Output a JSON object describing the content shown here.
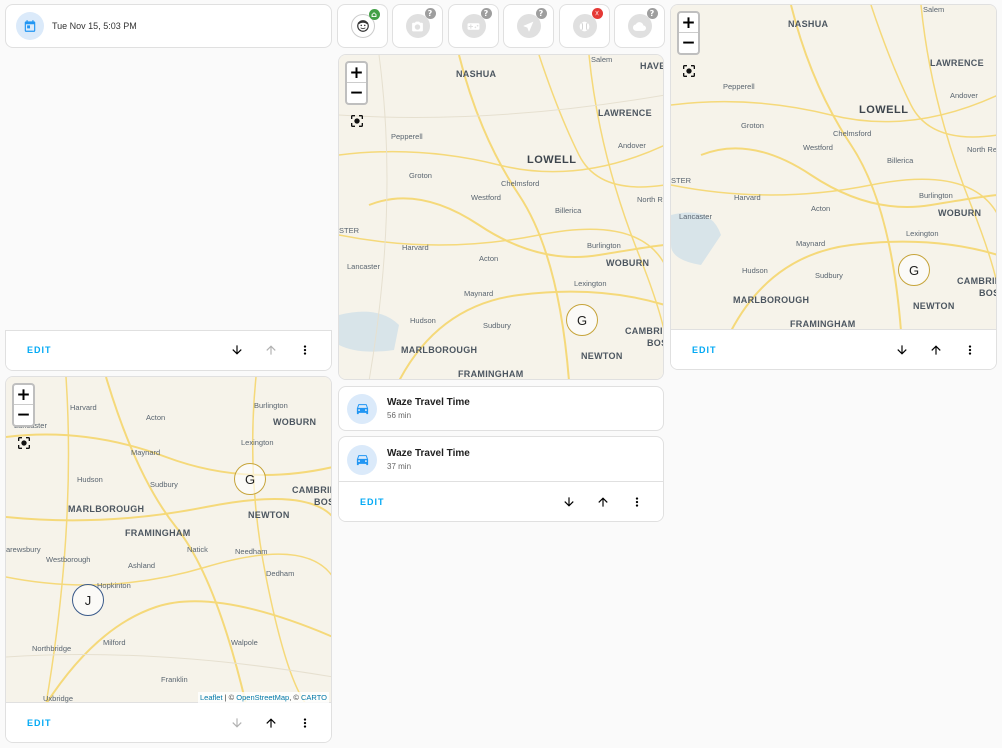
{
  "date_card": {
    "datetime": "Tue Nov 15, 5:03 PM",
    "icon": "calendar-icon"
  },
  "card_actions": {
    "edit_label": "EDIT"
  },
  "badges": [
    {
      "name": "person-badge",
      "icon": "face-icon",
      "state_badge": "home",
      "badge_color": "#43a047"
    },
    {
      "name": "camera-badge",
      "icon": "camera-icon",
      "state_badge": "?"
    },
    {
      "name": "gamepad-badge",
      "icon": "gamepad-icon",
      "state_badge": "?"
    },
    {
      "name": "navigation-badge",
      "icon": "navigation-icon",
      "state_badge": "?"
    },
    {
      "name": "baseball-badge",
      "icon": "baseball-icon",
      "state_badge": "away",
      "badge_color": "#e53935"
    },
    {
      "name": "weather-badge",
      "icon": "weather-icon",
      "state_badge": "?"
    }
  ],
  "travel": [
    {
      "name": "Waze Travel Time",
      "state": "56 min",
      "icon": "car-icon"
    },
    {
      "name": "Waze Travel Time",
      "state": "37 min",
      "icon": "car-icon"
    }
  ],
  "map_labels": {
    "bigcity": [
      "LOWELL"
    ],
    "cities": [
      "NASHUA",
      "LAWRENCE",
      "WOBURN",
      "MARLBOROUGH",
      "NEWTON",
      "FRAMINGHAM",
      "CAMBRIDGE",
      "BOS",
      "HAVER",
      "North Re"
    ],
    "towns": [
      "Salem",
      "Andover",
      "Pepperell",
      "Groton",
      "Chelmsford",
      "Westford",
      "Billerica",
      "North Re",
      "Harvard",
      "Acton",
      "Burlington",
      "Lancaster",
      "Maynard",
      "Lexington",
      "Hudson",
      "Sudbury",
      "STER"
    ],
    "sw_cities": [
      "WOBURN",
      "MARLBOROUGH",
      "NEWTON",
      "FRAMINGHAM",
      "CAMBRIDGE",
      "BOS"
    ],
    "sw_towns": [
      "Harvard",
      "Acton",
      "Burlington",
      "Lancaster",
      "Lexington",
      "Maynard",
      "Hudson",
      "Sudbury",
      "Natick",
      "Needham",
      "Westborough",
      "Ashland",
      "Hopkinton",
      "Dedham",
      "Northbridge",
      "Milford",
      "Walpole",
      "Franklin",
      "Uxbridge",
      "arewsbury"
    ]
  },
  "markers": {
    "g": "G",
    "j": "J"
  },
  "attribution": {
    "leaflet": "Leaflet",
    "sep1": " | © ",
    "osm": "OpenStreetMap",
    "sep2": ", © ",
    "carto": "CARTO"
  },
  "zoom": {
    "in": "+",
    "out": "−"
  },
  "colors": {
    "accent": "#03a9f4",
    "road": "#f5d97a",
    "water": "#c5dbe8",
    "park": "#dde8cf"
  }
}
